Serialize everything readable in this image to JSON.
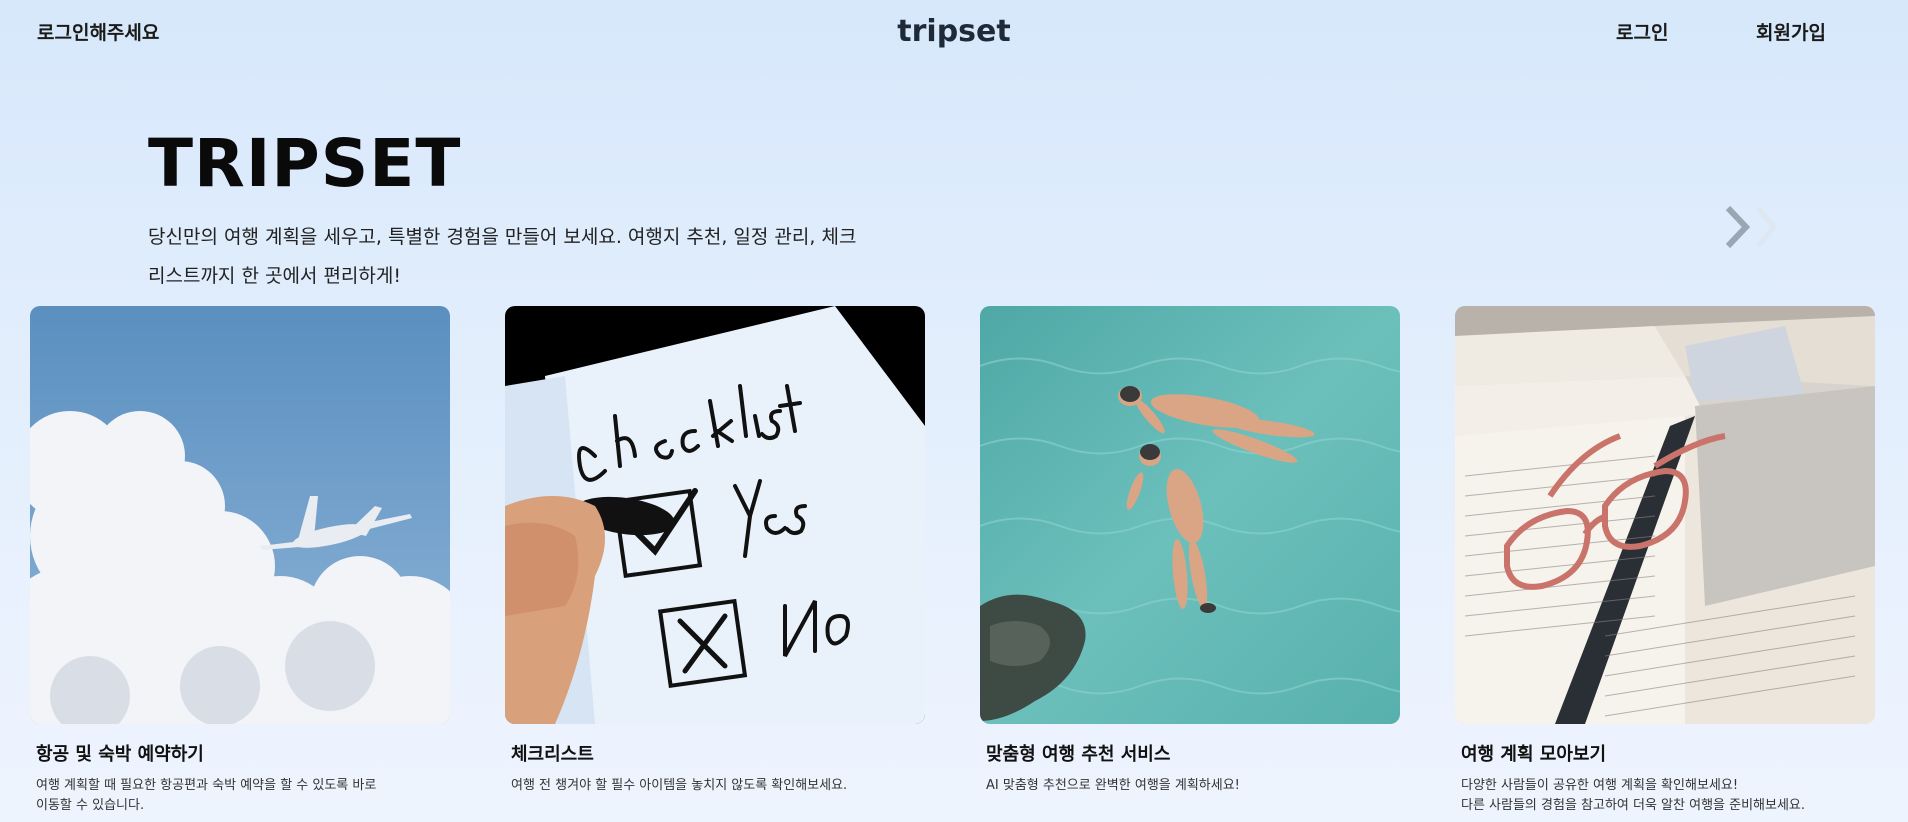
{
  "header": {
    "greeting": "로그인해주세요",
    "brand": "tripset",
    "login_label": "로그인",
    "signup_label": "회원가입"
  },
  "hero": {
    "title": "TRIPSET",
    "description": "당신만의 여행 계획을 세우고, 특별한 경험을 만들어 보세요. 여행지 추천, 일정 관리, 체크리스트까지 한 곳에서 편리하게!"
  },
  "cards": [
    {
      "title": "항공 및 숙박 예약하기",
      "description": "여행 계획할 때 필요한 항공편과 숙박 예약을 할 수 있도록 바로\n이동할 수 있습니다."
    },
    {
      "title": "체크리스트",
      "description": "여행 전 챙겨야 할 필수 아이템을 놓치지 않도록 확인해보세요."
    },
    {
      "title": "맞춤형 여행 추천 서비스",
      "description": "AI 맞춤형 추천으로 완벽한 여행을 계획하세요!"
    },
    {
      "title": "여행 계획 모아보기",
      "description": "다양한 사람들이 공유한 여행 계획을 확인해보세요!\n다른 사람들의 경험을 참고하여 더욱 알찬 여행을 준비해보세요."
    }
  ],
  "icons": {
    "carousel_next": "chevron-right-double-icon"
  },
  "colors": {
    "background": "#d7e8fb",
    "brand_text": "#1e2a38"
  }
}
